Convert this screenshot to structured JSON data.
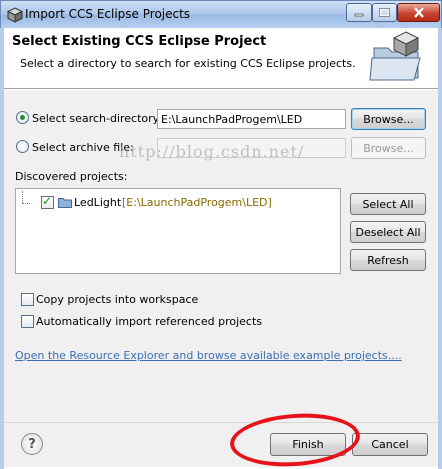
{
  "window": {
    "title": "Import CCS Eclipse Projects",
    "controls": {
      "minimize": "–",
      "maximize": "□",
      "close": "✕"
    }
  },
  "header": {
    "heading": "Select Existing CCS Eclipse Project",
    "description": "Select a directory to search for existing CCS Eclipse projects."
  },
  "options": {
    "search_directory": {
      "label": "Select search-directory:",
      "value": "E:\\LaunchPadProgem\\LED",
      "browse": "Browse...",
      "selected": true
    },
    "archive_file": {
      "label": "Select archive file:",
      "value": "",
      "browse": "Browse...",
      "selected": false
    }
  },
  "discovered": {
    "label": "Discovered projects:",
    "projects": [
      {
        "name": "LedLight",
        "path": "[E:\\LaunchPadProgem\\LED]",
        "checked": true
      }
    ],
    "buttons": {
      "select_all": "Select All",
      "deselect_all": "Deselect All",
      "refresh": "Refresh"
    }
  },
  "watermark": "http://blog.csdn.net/",
  "checkboxes": {
    "copy": {
      "label": "Copy projects into workspace",
      "checked": false
    },
    "auto_import": {
      "label": "Automatically import referenced projects",
      "checked": false
    }
  },
  "resource_link": "Open the Resource Explorer and browse available example projects....",
  "footer": {
    "help": "?",
    "finish": "Finish",
    "cancel": "Cancel"
  },
  "colors": {
    "link": "#3c6fb4",
    "annotation": "#e8121a",
    "path_text": "#8a6a00"
  }
}
